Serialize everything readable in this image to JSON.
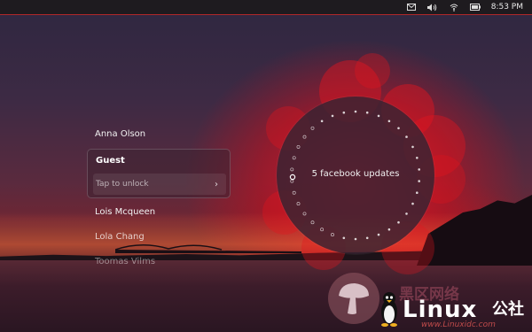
{
  "panel": {
    "clock": "8:53 PM",
    "icons": [
      "mail-icon",
      "volume-icon",
      "network-icon",
      "battery-icon"
    ]
  },
  "greeter": {
    "users": [
      "Anna Olson"
    ],
    "selected_user": "Guest",
    "unlock_placeholder": "Tap to unlock",
    "users_after": [
      "Lois Mcqueen",
      "Lola Chang",
      "Toomas Vilms"
    ]
  },
  "infographic": {
    "text": "5 facebook updates",
    "accent_color": "#e0141e"
  },
  "watermark": {
    "brand": "Linux",
    "brand_suffix": "公社",
    "site_name": "黑区网络",
    "url": "www.Linuxidc.com"
  }
}
